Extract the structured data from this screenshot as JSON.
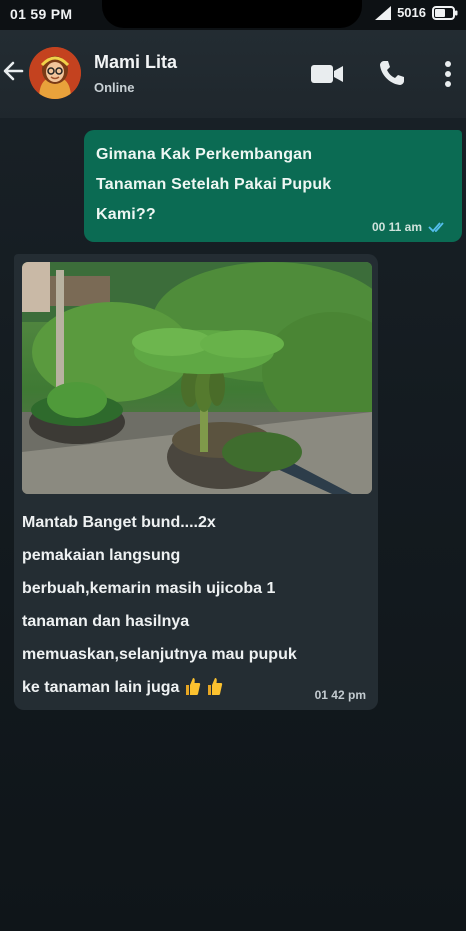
{
  "status_bar": {
    "time": "01 59 PM",
    "network": "5016"
  },
  "header": {
    "contact_name": "Mami Lita",
    "contact_status": "Online"
  },
  "messages": [
    {
      "direction": "outgoing",
      "text": "Gimana Kak Perkembangan\nTanaman Setelah Pakai Pupuk\nKami??",
      "time": "00 11 am",
      "status": "read"
    },
    {
      "direction": "incoming",
      "has_image": true,
      "text": "Mantab Banget bund....2x\npemakaian langsung\nberbuah,kemarin masih ujicoba 1\ntanaman dan hasilnya\nmemuaskan,selanjutnya mau pupuk\nke tanaman lain juga",
      "emoji": "thumbs-up-icon x2",
      "time": "01 42 pm"
    }
  ],
  "colors": {
    "outgoing_bubble": "#0b6b53",
    "incoming_bubble": "#242d33",
    "header_bg": "#1f272d",
    "read_tick": "#53bdeb"
  }
}
